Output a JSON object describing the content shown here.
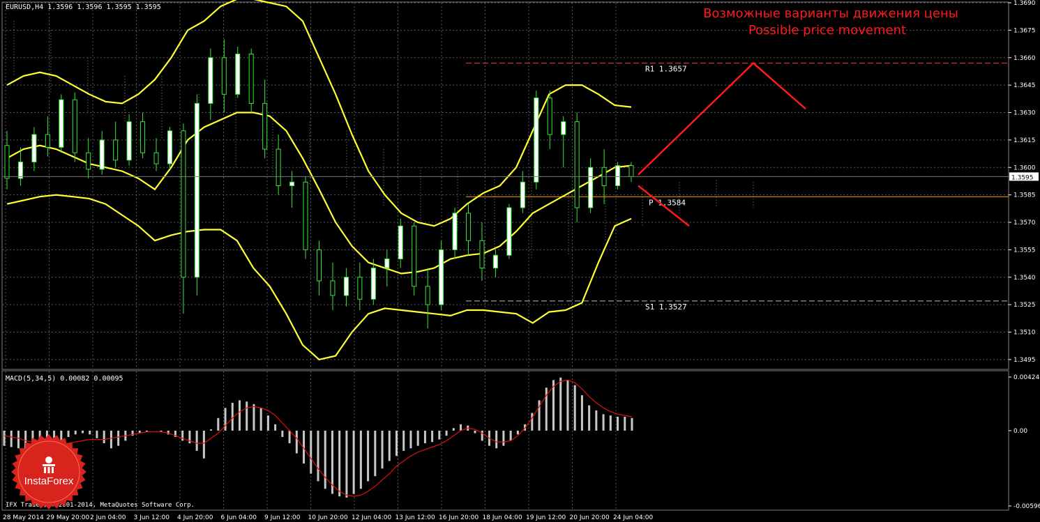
{
  "chart_data": {
    "type": "line",
    "symbol_header": "EURUSD,H4  1.3596 1.3596 1.3595 1.3595",
    "annotation": {
      "ru": "Возможные варианты движения цены",
      "en": "Possible price movement"
    },
    "price_axis": {
      "min": 1.349,
      "max": 1.369,
      "ticks": [
        "1.3690",
        "1.3675",
        "1.3660",
        "1.3645",
        "1.3630",
        "1.3615",
        "1.3600",
        "1.3585",
        "1.3570",
        "1.3555",
        "1.3540",
        "1.3525",
        "1.3510",
        "1.3495"
      ]
    },
    "current_price": {
      "label": "1.3595",
      "value": 1.3595
    },
    "levels": [
      {
        "name": "R1",
        "label": "R1 1.3657",
        "value": 1.3657,
        "color": "#ff3b3b"
      },
      {
        "name": "P",
        "label": "P 1.3584",
        "value": 1.3584,
        "color": "#ffa500"
      },
      {
        "name": "S1",
        "label": "S1 1.3527",
        "value": 1.3527,
        "color": "#c0c0c0"
      }
    ],
    "time_labels": [
      "28 May 2014",
      "29 May 20:00",
      "2 Jun 04:00",
      "3 Jun 12:00",
      "4 Jun 20:00",
      "6 Jun 04:00",
      "9 Jun 12:00",
      "10 Jun 20:00",
      "12 Jun 04:00",
      "13 Jun 12:00",
      "16 Jun 20:00",
      "18 Jun 04:00",
      "19 Jun 12:00",
      "20 Jun 20:00",
      "24 Jun 04:00"
    ],
    "bollinger_upper": [
      1.3645,
      1.365,
      1.3652,
      1.365,
      1.3645,
      1.364,
      1.3636,
      1.3635,
      1.364,
      1.3648,
      1.366,
      1.3675,
      1.368,
      1.3688,
      1.3692,
      1.3692,
      1.369,
      1.3688,
      1.368,
      1.366,
      1.364,
      1.3618,
      1.3598,
      1.3585,
      1.3575,
      1.357,
      1.3568,
      1.3572,
      1.358,
      1.3586,
      1.359,
      1.36,
      1.362,
      1.364,
      1.3645,
      1.3645,
      1.364,
      1.3634,
      1.3633
    ],
    "bollinger_middle": [
      1.3605,
      1.361,
      1.3612,
      1.361,
      1.3606,
      1.3602,
      1.36,
      1.3598,
      1.3594,
      1.3588,
      1.36,
      1.3615,
      1.3622,
      1.3626,
      1.363,
      1.363,
      1.3628,
      1.362,
      1.3605,
      1.3588,
      1.357,
      1.3557,
      1.3548,
      1.3545,
      1.3542,
      1.3543,
      1.3545,
      1.355,
      1.3552,
      1.3553,
      1.3557,
      1.3565,
      1.3575,
      1.358,
      1.3585,
      1.359,
      1.3595,
      1.36,
      1.3601
    ],
    "bollinger_lower": [
      1.358,
      1.3582,
      1.3584,
      1.3585,
      1.3584,
      1.3583,
      1.358,
      1.3574,
      1.3568,
      1.356,
      1.3563,
      1.3565,
      1.3566,
      1.3566,
      1.356,
      1.3545,
      1.3535,
      1.352,
      1.3503,
      1.3495,
      1.3497,
      1.351,
      1.352,
      1.3523,
      1.3522,
      1.3521,
      1.352,
      1.3519,
      1.3522,
      1.3522,
      1.3521,
      1.352,
      1.3515,
      1.3521,
      1.3522,
      1.3526,
      1.3548,
      1.3568,
      1.3572
    ],
    "candles": [
      {
        "o": 1.3612,
        "h": 1.362,
        "l": 1.3588,
        "c": 1.3594
      },
      {
        "o": 1.3594,
        "h": 1.3611,
        "l": 1.359,
        "c": 1.3603
      },
      {
        "o": 1.3603,
        "h": 1.3622,
        "l": 1.3598,
        "c": 1.3618
      },
      {
        "o": 1.3618,
        "h": 1.3628,
        "l": 1.3606,
        "c": 1.3611
      },
      {
        "o": 1.3611,
        "h": 1.364,
        "l": 1.3608,
        "c": 1.3637
      },
      {
        "o": 1.3637,
        "h": 1.3641,
        "l": 1.3603,
        "c": 1.3608
      },
      {
        "o": 1.3608,
        "h": 1.3616,
        "l": 1.3594,
        "c": 1.3599
      },
      {
        "o": 1.3599,
        "h": 1.362,
        "l": 1.3596,
        "c": 1.3615
      },
      {
        "o": 1.3615,
        "h": 1.3625,
        "l": 1.36,
        "c": 1.3604
      },
      {
        "o": 1.3604,
        "h": 1.3629,
        "l": 1.3601,
        "c": 1.3625
      },
      {
        "o": 1.3625,
        "h": 1.363,
        "l": 1.3605,
        "c": 1.3608
      },
      {
        "o": 1.3608,
        "h": 1.3616,
        "l": 1.3598,
        "c": 1.3602
      },
      {
        "o": 1.3602,
        "h": 1.3622,
        "l": 1.3599,
        "c": 1.362
      },
      {
        "o": 1.362,
        "h": 1.3624,
        "l": 1.352,
        "c": 1.354
      },
      {
        "o": 1.354,
        "h": 1.364,
        "l": 1.353,
        "c": 1.3635
      },
      {
        "o": 1.3635,
        "h": 1.3665,
        "l": 1.3626,
        "c": 1.366
      },
      {
        "o": 1.366,
        "h": 1.367,
        "l": 1.363,
        "c": 1.364
      },
      {
        "o": 1.364,
        "h": 1.3666,
        "l": 1.3638,
        "c": 1.3662
      },
      {
        "o": 1.3662,
        "h": 1.3665,
        "l": 1.363,
        "c": 1.3635
      },
      {
        "o": 1.3635,
        "h": 1.3648,
        "l": 1.3605,
        "c": 1.361
      },
      {
        "o": 1.361,
        "h": 1.3618,
        "l": 1.3585,
        "c": 1.359
      },
      {
        "o": 1.359,
        "h": 1.3598,
        "l": 1.3578,
        "c": 1.3592
      },
      {
        "o": 1.3592,
        "h": 1.3595,
        "l": 1.355,
        "c": 1.3555
      },
      {
        "o": 1.3555,
        "h": 1.356,
        "l": 1.353,
        "c": 1.3538
      },
      {
        "o": 1.3538,
        "h": 1.3548,
        "l": 1.3522,
        "c": 1.353
      },
      {
        "o": 1.353,
        "h": 1.3545,
        "l": 1.3524,
        "c": 1.354
      },
      {
        "o": 1.354,
        "h": 1.3548,
        "l": 1.3522,
        "c": 1.3528
      },
      {
        "o": 1.3528,
        "h": 1.355,
        "l": 1.3525,
        "c": 1.3545
      },
      {
        "o": 1.3545,
        "h": 1.3555,
        "l": 1.3535,
        "c": 1.355
      },
      {
        "o": 1.355,
        "h": 1.3572,
        "l": 1.3545,
        "c": 1.3568
      },
      {
        "o": 1.3568,
        "h": 1.357,
        "l": 1.353,
        "c": 1.3535
      },
      {
        "o": 1.3535,
        "h": 1.3545,
        "l": 1.3512,
        "c": 1.3525
      },
      {
        "o": 1.3525,
        "h": 1.356,
        "l": 1.3522,
        "c": 1.3555
      },
      {
        "o": 1.3555,
        "h": 1.3578,
        "l": 1.355,
        "c": 1.3575
      },
      {
        "o": 1.3575,
        "h": 1.358,
        "l": 1.3552,
        "c": 1.356
      },
      {
        "o": 1.356,
        "h": 1.357,
        "l": 1.3538,
        "c": 1.3545
      },
      {
        "o": 1.3545,
        "h": 1.3555,
        "l": 1.354,
        "c": 1.3552
      },
      {
        "o": 1.3552,
        "h": 1.358,
        "l": 1.355,
        "c": 1.3578
      },
      {
        "o": 1.3578,
        "h": 1.3598,
        "l": 1.3575,
        "c": 1.3592
      },
      {
        "o": 1.3592,
        "h": 1.3642,
        "l": 1.3588,
        "c": 1.3638
      },
      {
        "o": 1.3638,
        "h": 1.3642,
        "l": 1.361,
        "c": 1.3618
      },
      {
        "o": 1.3618,
        "h": 1.3628,
        "l": 1.36,
        "c": 1.3625
      },
      {
        "o": 1.3625,
        "h": 1.363,
        "l": 1.357,
        "c": 1.3578
      },
      {
        "o": 1.3578,
        "h": 1.3605,
        "l": 1.3575,
        "c": 1.36
      },
      {
        "o": 1.36,
        "h": 1.361,
        "l": 1.358,
        "c": 1.359
      },
      {
        "o": 1.359,
        "h": 1.3603,
        "l": 1.3588,
        "c": 1.3601
      },
      {
        "o": 1.3601,
        "h": 1.3603,
        "l": 1.3592,
        "c": 1.3595
      }
    ],
    "forecast": [
      {
        "from": 1.3596,
        "to": 1.3657,
        "then": 1.3632
      },
      {
        "from": 1.359,
        "to": 1.3568
      }
    ],
    "macd": {
      "label": "MACD(5,34,5) 0.00082 0.00095",
      "axis_ticks": [
        "0.00424",
        "0.00",
        "-0.00596"
      ],
      "min": -0.00596,
      "max": 0.00424,
      "histogram": [
        -0.0012,
        -0.0013,
        -0.0014,
        -0.0015,
        -0.0014,
        -0.0013,
        -0.0012,
        -0.001,
        -0.0008,
        -0.0005,
        -0.0003,
        -0.0002,
        -0.0003,
        -0.0006,
        -0.001,
        -0.0014,
        -0.0012,
        -0.0008,
        -0.0004,
        -0.0002,
        -0.0001,
        0.0,
        -0.0001,
        -0.0003,
        -0.0005,
        -0.0008,
        -0.001,
        -0.0016,
        -0.0022,
        0.0001,
        0.001,
        0.0018,
        0.0022,
        0.0024,
        0.0023,
        0.0021,
        0.0018,
        0.0012,
        0.0005,
        -0.0005,
        -0.001,
        -0.0018,
        -0.0026,
        -0.0034,
        -0.004,
        -0.0046,
        -0.005,
        -0.0052,
        -0.0053,
        -0.005,
        -0.0046,
        -0.004,
        -0.0036,
        -0.003,
        -0.0024,
        -0.002,
        -0.0016,
        -0.0014,
        -0.0012,
        -0.001,
        -0.0009,
        -0.0007,
        -0.0004,
        0.0002,
        0.0005,
        0.0004,
        -0.0002,
        -0.0008,
        -0.0012,
        -0.0014,
        -0.0012,
        -0.0008,
        -0.0003,
        0.0005,
        0.0014,
        0.0024,
        0.0034,
        0.004,
        0.0042,
        0.004,
        0.0036,
        0.0028,
        0.002,
        0.0016,
        0.0013,
        0.0012,
        0.0011,
        0.0011,
        0.001
      ],
      "signal": [
        -0.0004,
        -0.0005,
        -0.0006,
        -0.0008,
        -0.0009,
        -0.001,
        -0.0011,
        -0.0011,
        -0.0011,
        -0.001,
        -0.0009,
        -0.0008,
        -0.0007,
        -0.0007,
        -0.0007,
        -0.0006,
        -0.0005,
        -0.0004,
        -0.0003,
        -0.0002,
        -0.0001,
        -0.0001,
        -0.0001,
        -0.0002,
        -0.0004,
        -0.0006,
        -0.0008,
        -0.001,
        -0.001,
        -0.0006,
        -0.0002,
        0.0004,
        0.001,
        0.0015,
        0.0018,
        0.0019,
        0.0018,
        0.0016,
        0.0012,
        0.0006,
        0.0,
        -0.0006,
        -0.0014,
        -0.0022,
        -0.003,
        -0.0037,
        -0.0043,
        -0.0048,
        -0.0051,
        -0.0052,
        -0.0051,
        -0.0048,
        -0.0044,
        -0.0039,
        -0.0034,
        -0.0028,
        -0.0024,
        -0.002,
        -0.0017,
        -0.0015,
        -0.0013,
        -0.0011,
        -0.0008,
        -0.0004,
        0.0,
        0.0002,
        0.0001,
        -0.0002,
        -0.0006,
        -0.0009,
        -0.0009,
        -0.0008,
        -0.0004,
        0.0002,
        0.001,
        0.0019,
        0.0028,
        0.0035,
        0.0039,
        0.004,
        0.0038,
        0.0033,
        0.0027,
        0.0022,
        0.0018,
        0.0015,
        0.0013,
        0.0012,
        0.0011
      ]
    }
  },
  "footer": {
    "copyright": "IFX Trader, © 2001-2014, MetaQuotes Software Corp."
  },
  "brand": {
    "logo_text": "InstaForex",
    "logo_color": "#d9231d"
  }
}
